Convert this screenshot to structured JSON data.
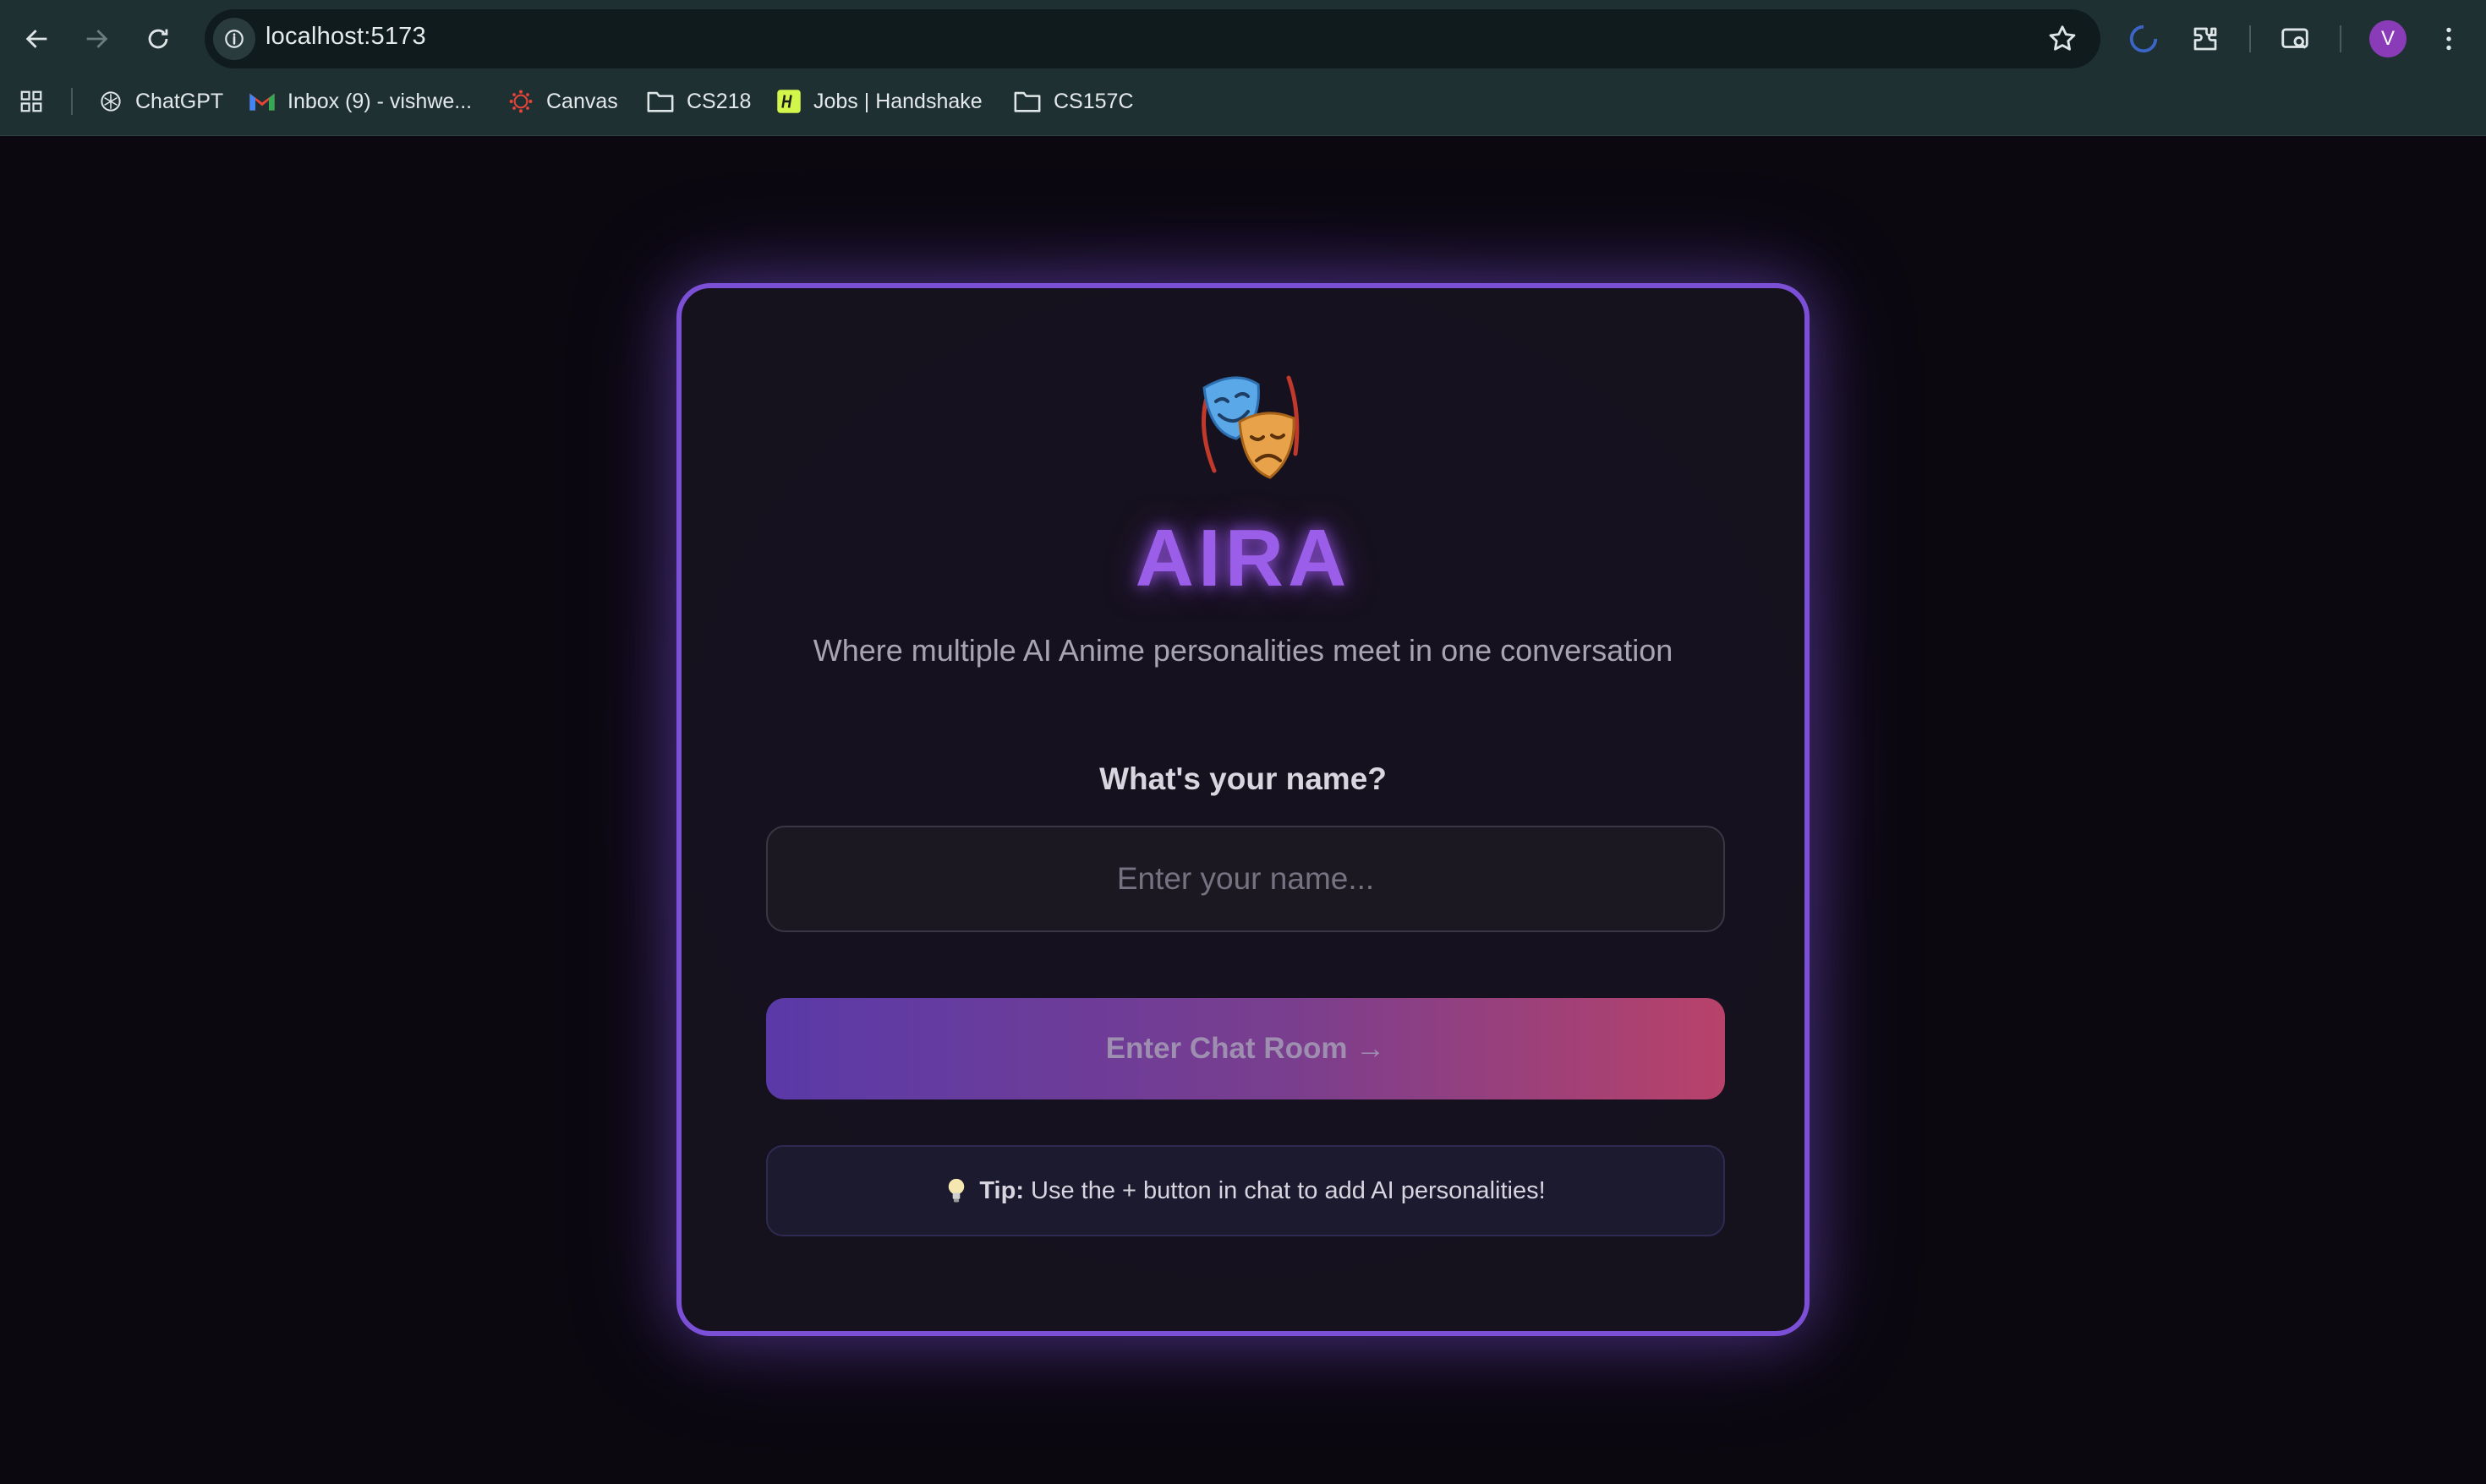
{
  "browser": {
    "url": "localhost:5173",
    "avatar_letter": "V",
    "bookmarks": [
      {
        "label": "ChatGPT",
        "icon": "chatgpt-icon"
      },
      {
        "label": "Inbox (9) - vishwe...",
        "icon": "gmail-icon"
      },
      {
        "label": "Canvas",
        "icon": "canvas-icon"
      },
      {
        "label": "CS218",
        "icon": "folder-icon"
      },
      {
        "label": "Jobs | Handshake",
        "icon": "handshake-icon"
      },
      {
        "label": "CS157C",
        "icon": "folder-icon"
      }
    ]
  },
  "app": {
    "logo_icon": "theater-masks-icon",
    "title": "AIRA",
    "tagline": "Where multiple AI Anime personalities meet in one conversation",
    "question": "What's your name?",
    "name_placeholder": "Enter your name...",
    "name_value": "",
    "enter_label": "Enter Chat Room →",
    "tip_label": "Tip:",
    "tip_text": "Use the + button in chat to add AI personalities!",
    "tip_icon": "lightbulb-icon",
    "colors": {
      "accent": "#7b4fd6",
      "title": "#9b5ee8",
      "button_start": "#5a3aa8",
      "button_end": "#b8426a"
    }
  }
}
